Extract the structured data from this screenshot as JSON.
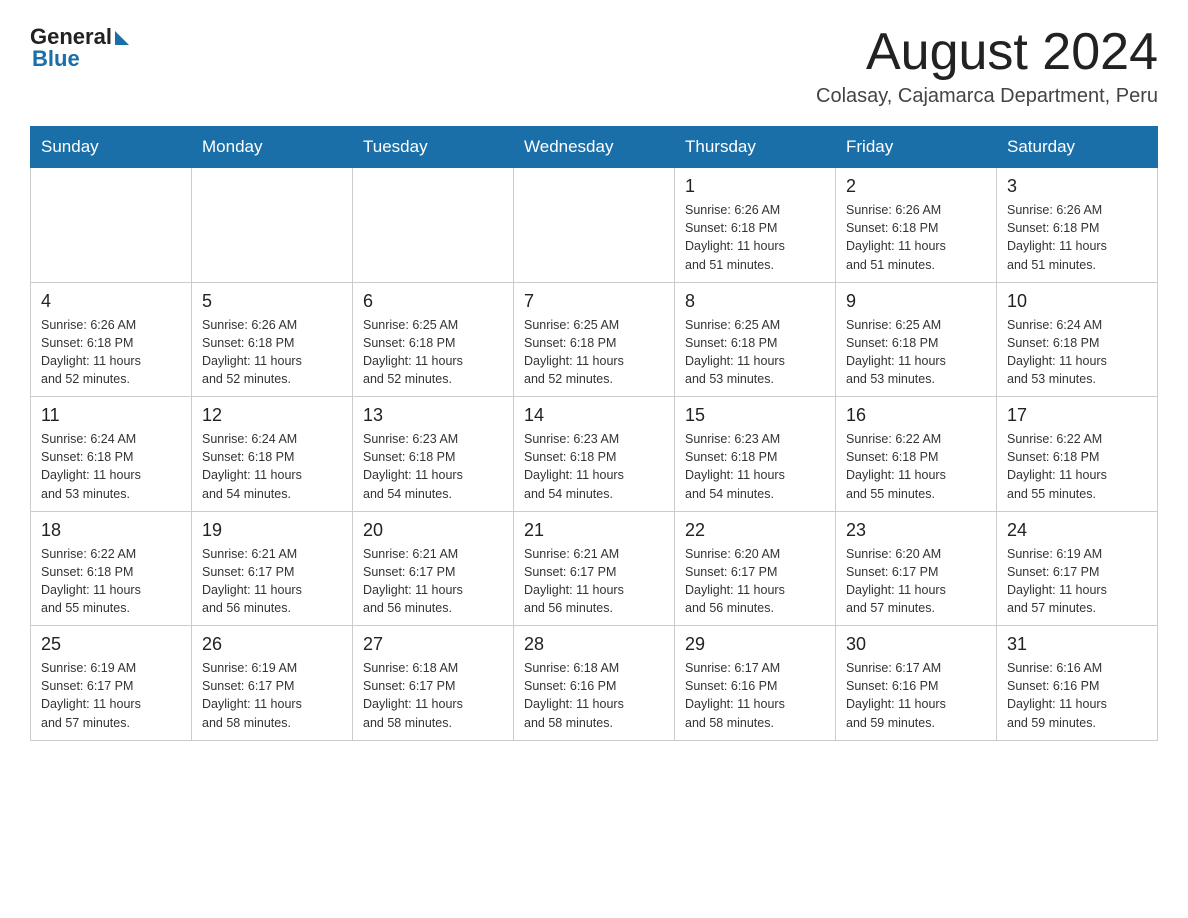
{
  "header": {
    "logo_general": "General",
    "logo_blue": "Blue",
    "title": "August 2024",
    "subtitle": "Colasay, Cajamarca Department, Peru"
  },
  "days_of_week": [
    "Sunday",
    "Monday",
    "Tuesday",
    "Wednesday",
    "Thursday",
    "Friday",
    "Saturday"
  ],
  "weeks": [
    [
      {
        "day": "",
        "info": ""
      },
      {
        "day": "",
        "info": ""
      },
      {
        "day": "",
        "info": ""
      },
      {
        "day": "",
        "info": ""
      },
      {
        "day": "1",
        "info": "Sunrise: 6:26 AM\nSunset: 6:18 PM\nDaylight: 11 hours\nand 51 minutes."
      },
      {
        "day": "2",
        "info": "Sunrise: 6:26 AM\nSunset: 6:18 PM\nDaylight: 11 hours\nand 51 minutes."
      },
      {
        "day": "3",
        "info": "Sunrise: 6:26 AM\nSunset: 6:18 PM\nDaylight: 11 hours\nand 51 minutes."
      }
    ],
    [
      {
        "day": "4",
        "info": "Sunrise: 6:26 AM\nSunset: 6:18 PM\nDaylight: 11 hours\nand 52 minutes."
      },
      {
        "day": "5",
        "info": "Sunrise: 6:26 AM\nSunset: 6:18 PM\nDaylight: 11 hours\nand 52 minutes."
      },
      {
        "day": "6",
        "info": "Sunrise: 6:25 AM\nSunset: 6:18 PM\nDaylight: 11 hours\nand 52 minutes."
      },
      {
        "day": "7",
        "info": "Sunrise: 6:25 AM\nSunset: 6:18 PM\nDaylight: 11 hours\nand 52 minutes."
      },
      {
        "day": "8",
        "info": "Sunrise: 6:25 AM\nSunset: 6:18 PM\nDaylight: 11 hours\nand 53 minutes."
      },
      {
        "day": "9",
        "info": "Sunrise: 6:25 AM\nSunset: 6:18 PM\nDaylight: 11 hours\nand 53 minutes."
      },
      {
        "day": "10",
        "info": "Sunrise: 6:24 AM\nSunset: 6:18 PM\nDaylight: 11 hours\nand 53 minutes."
      }
    ],
    [
      {
        "day": "11",
        "info": "Sunrise: 6:24 AM\nSunset: 6:18 PM\nDaylight: 11 hours\nand 53 minutes."
      },
      {
        "day": "12",
        "info": "Sunrise: 6:24 AM\nSunset: 6:18 PM\nDaylight: 11 hours\nand 54 minutes."
      },
      {
        "day": "13",
        "info": "Sunrise: 6:23 AM\nSunset: 6:18 PM\nDaylight: 11 hours\nand 54 minutes."
      },
      {
        "day": "14",
        "info": "Sunrise: 6:23 AM\nSunset: 6:18 PM\nDaylight: 11 hours\nand 54 minutes."
      },
      {
        "day": "15",
        "info": "Sunrise: 6:23 AM\nSunset: 6:18 PM\nDaylight: 11 hours\nand 54 minutes."
      },
      {
        "day": "16",
        "info": "Sunrise: 6:22 AM\nSunset: 6:18 PM\nDaylight: 11 hours\nand 55 minutes."
      },
      {
        "day": "17",
        "info": "Sunrise: 6:22 AM\nSunset: 6:18 PM\nDaylight: 11 hours\nand 55 minutes."
      }
    ],
    [
      {
        "day": "18",
        "info": "Sunrise: 6:22 AM\nSunset: 6:18 PM\nDaylight: 11 hours\nand 55 minutes."
      },
      {
        "day": "19",
        "info": "Sunrise: 6:21 AM\nSunset: 6:17 PM\nDaylight: 11 hours\nand 56 minutes."
      },
      {
        "day": "20",
        "info": "Sunrise: 6:21 AM\nSunset: 6:17 PM\nDaylight: 11 hours\nand 56 minutes."
      },
      {
        "day": "21",
        "info": "Sunrise: 6:21 AM\nSunset: 6:17 PM\nDaylight: 11 hours\nand 56 minutes."
      },
      {
        "day": "22",
        "info": "Sunrise: 6:20 AM\nSunset: 6:17 PM\nDaylight: 11 hours\nand 56 minutes."
      },
      {
        "day": "23",
        "info": "Sunrise: 6:20 AM\nSunset: 6:17 PM\nDaylight: 11 hours\nand 57 minutes."
      },
      {
        "day": "24",
        "info": "Sunrise: 6:19 AM\nSunset: 6:17 PM\nDaylight: 11 hours\nand 57 minutes."
      }
    ],
    [
      {
        "day": "25",
        "info": "Sunrise: 6:19 AM\nSunset: 6:17 PM\nDaylight: 11 hours\nand 57 minutes."
      },
      {
        "day": "26",
        "info": "Sunrise: 6:19 AM\nSunset: 6:17 PM\nDaylight: 11 hours\nand 58 minutes."
      },
      {
        "day": "27",
        "info": "Sunrise: 6:18 AM\nSunset: 6:17 PM\nDaylight: 11 hours\nand 58 minutes."
      },
      {
        "day": "28",
        "info": "Sunrise: 6:18 AM\nSunset: 6:16 PM\nDaylight: 11 hours\nand 58 minutes."
      },
      {
        "day": "29",
        "info": "Sunrise: 6:17 AM\nSunset: 6:16 PM\nDaylight: 11 hours\nand 58 minutes."
      },
      {
        "day": "30",
        "info": "Sunrise: 6:17 AM\nSunset: 6:16 PM\nDaylight: 11 hours\nand 59 minutes."
      },
      {
        "day": "31",
        "info": "Sunrise: 6:16 AM\nSunset: 6:16 PM\nDaylight: 11 hours\nand 59 minutes."
      }
    ]
  ]
}
